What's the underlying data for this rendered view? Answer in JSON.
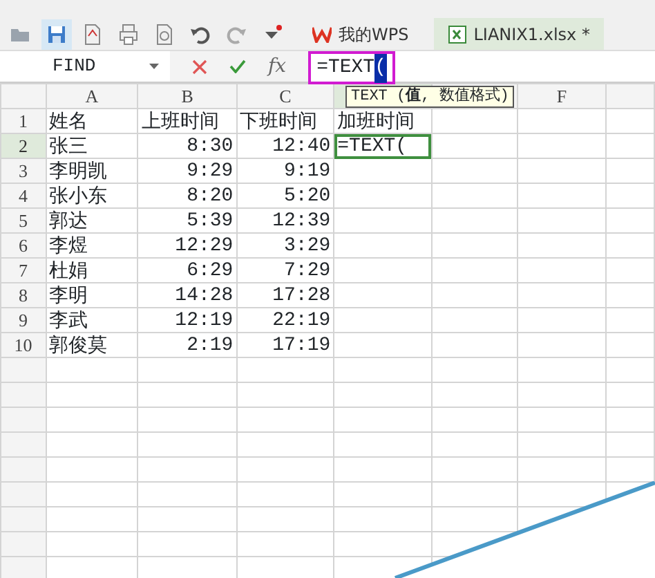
{
  "quick_access": [
    {
      "kind": "open",
      "selected": false
    },
    {
      "kind": "save",
      "selected": true
    },
    {
      "kind": "pdf",
      "selected": false
    },
    {
      "kind": "print",
      "selected": false
    },
    {
      "kind": "preview",
      "selected": false
    },
    {
      "kind": "undo",
      "selected": false
    },
    {
      "kind": "redo",
      "selected": false
    },
    {
      "kind": "customize",
      "selected": false
    }
  ],
  "tabs": [
    {
      "label": "我的WPS",
      "kind": "home",
      "selected": false
    },
    {
      "label": "LIANIX1.xlsx *",
      "kind": "workbook",
      "selected": true
    }
  ],
  "formula_bar": {
    "name_box": "FIND",
    "fx": "fx",
    "formula": [
      {
        "text": "=TEXT",
        "selected": false
      },
      {
        "text": "(",
        "selected": true
      }
    ]
  },
  "tooltip": "TEXT (**值**, 数值格式)",
  "columns": [
    {
      "label": "A",
      "kind": "text",
      "selected": false
    },
    {
      "label": "B",
      "kind": "time",
      "selected": false
    },
    {
      "label": "C",
      "kind": "time",
      "selected": false
    },
    {
      "kind": "text",
      "selected": true
    },
    {
      "kind": "text",
      "selected": false
    },
    {
      "label": "F",
      "kind": "text",
      "selected": false
    }
  ],
  "rows": [
    {
      "number": "1",
      "kind": "header",
      "selected": false,
      "cells": [
        "姓名",
        "上班时间",
        "下班时间",
        "加班时间"
      ]
    },
    {
      "number": "2",
      "kind": "data",
      "selected": true,
      "cells": [
        "张三",
        "8:30",
        "12:40",
        "=TEXT("
      ]
    },
    {
      "number": "3",
      "kind": "data",
      "selected": false,
      "cells": [
        "李明凯",
        "9:29",
        "9:19"
      ]
    },
    {
      "number": "4",
      "kind": "data",
      "selected": false,
      "cells": [
        "张小东",
        "8:20",
        "5:20"
      ]
    },
    {
      "number": "5",
      "kind": "data",
      "selected": false,
      "cells": [
        "郭达",
        "5:39",
        "12:39"
      ]
    },
    {
      "number": "6",
      "kind": "data",
      "selected": false,
      "cells": [
        "李煜",
        "12:29",
        "3:29"
      ]
    },
    {
      "number": "7",
      "kind": "data",
      "selected": false,
      "cells": [
        "杜娟",
        "6:29",
        "7:29"
      ]
    },
    {
      "number": "8",
      "kind": "data",
      "selected": false,
      "cells": [
        "李明",
        "14:28",
        "17:28"
      ]
    },
    {
      "number": "9",
      "kind": "data",
      "selected": false,
      "cells": [
        "李武",
        "12:19",
        "22:19"
      ]
    },
    {
      "number": "10",
      "kind": "data",
      "selected": false,
      "cells": [
        "郭俊莫",
        "2:19",
        "17:19"
      ]
    }
  ]
}
